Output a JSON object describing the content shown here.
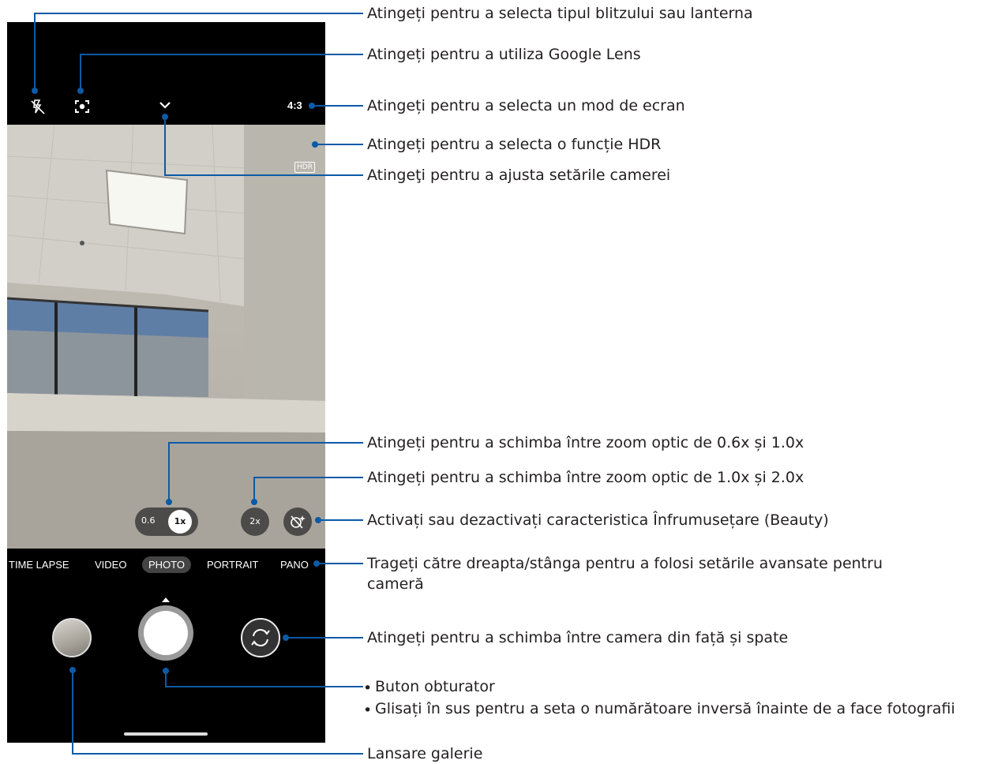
{
  "camera": {
    "topbar": {
      "flash_icon": "flash-off-icon",
      "lens_icon": "google-lens-icon",
      "settings_icon": "chevron-down-icon",
      "aspect_ratio": "4:3"
    },
    "viewfinder": {
      "hdr_badge": "HDR"
    },
    "zoom": {
      "wide": "0.6",
      "normal": "1x",
      "tele": "2x"
    },
    "beauty_icon": "beauty-off-icon",
    "modes": [
      "TIME LAPSE",
      "VIDEO",
      "PHOTO",
      "PORTRAIT",
      "PANO"
    ],
    "active_mode": "PHOTO",
    "switch_icon": "switch-camera-icon"
  },
  "callouts": {
    "flash": "Atingeți pentru a selecta tipul blitzului sau lanterna",
    "lens": "Atingeți pentru a utiliza Google Lens",
    "aspect": "Atingeți pentru a selecta un mod de ecran",
    "hdr": "Atingeți pentru a selecta o funcție HDR",
    "settings": "Atingeţi pentru a ajusta setările camerei",
    "zoom_06": "Atingeți pentru a schimba între zoom optic de 0.6x și 1.0x",
    "zoom_2x": "Atingeți pentru a schimba între zoom optic de 1.0x și 2.0x",
    "beauty": "Activați sau dezactivați caracteristica Înfrumusețare (Beauty)",
    "modes": "Trageți către dreapta/stânga pentru a folosi setările avansate pentru cameră",
    "switch": "Atingeți pentru a schimba între camera din față și spate",
    "shutter_1": "Buton obturator",
    "shutter_2": "Glisați în sus pentru a seta o numărătoare inversă înainte de a face fotografii",
    "gallery": "Lansare galerie",
    "bullet": "•"
  },
  "colors": {
    "callout_line": "#0b5aa6",
    "text": "#231f20"
  }
}
